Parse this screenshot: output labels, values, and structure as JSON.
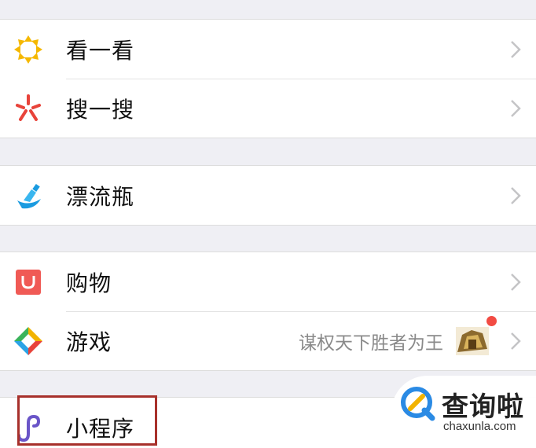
{
  "menu": {
    "group1": [
      {
        "label": "看一看",
        "icon": "look-icon"
      },
      {
        "label": "搜一搜",
        "icon": "search-icon"
      }
    ],
    "group2": [
      {
        "label": "漂流瓶",
        "icon": "drift-bottle-icon"
      }
    ],
    "group3": [
      {
        "label": "购物",
        "icon": "shopping-icon"
      },
      {
        "label": "游戏",
        "icon": "games-icon",
        "subtitle": "谋权天下胜者为王",
        "badge": "red-dot"
      }
    ],
    "group4": [
      {
        "label": "小程序",
        "icon": "mini-program-icon"
      }
    ]
  },
  "watermark": {
    "title": "查询啦",
    "url": "chaxunla.com"
  },
  "colors": {
    "background": "#efeff4",
    "highlight_border": "#a7302b",
    "badge": "#f24b43",
    "watermark_blue": "#2a8ae4"
  }
}
